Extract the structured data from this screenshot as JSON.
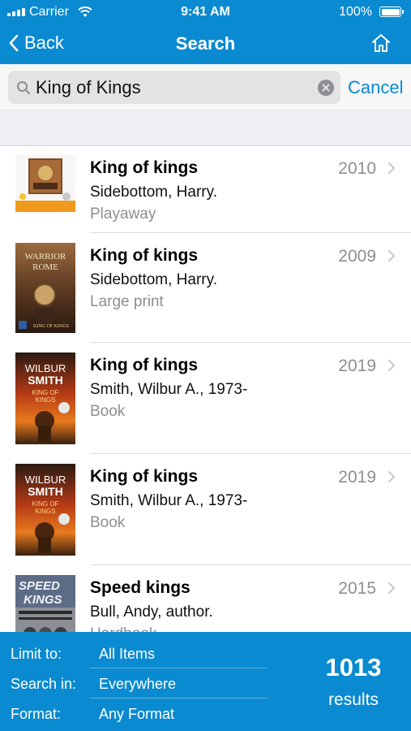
{
  "status_bar": {
    "carrier": "Carrier",
    "time": "9:41 AM",
    "battery": "100%"
  },
  "nav": {
    "back_label": "Back",
    "title": "Search",
    "home_icon": "home-icon"
  },
  "search": {
    "value": "King of Kings",
    "cancel_label": "Cancel"
  },
  "results": [
    {
      "title": "King of kings",
      "author": "Sidebottom, Harry.",
      "format": "Playaway",
      "year": "2010",
      "cover": "playaway"
    },
    {
      "title": "King of kings",
      "author": "Sidebottom, Harry.",
      "format": "Large print",
      "year": "2009",
      "cover": "warrior-of-rome",
      "cover_text": [
        "WARRIOR",
        "ROME",
        "KING OF KINGS"
      ]
    },
    {
      "title": "King of kings",
      "author": "Smith, Wilbur A., 1973-",
      "format": "Book",
      "year": "2019",
      "cover": "wilbur-smith",
      "cover_text": [
        "WILBUR",
        "SMITH",
        "KING OF",
        "KINGS"
      ]
    },
    {
      "title": "King of kings",
      "author": "Smith, Wilbur A., 1973-",
      "format": "Book",
      "year": "2019",
      "cover": "wilbur-smith",
      "cover_text": [
        "WILBUR",
        "SMITH",
        "KING OF",
        "KINGS"
      ]
    },
    {
      "title": "Speed kings",
      "author": "Bull, Andy, author.",
      "format": "Hardbook",
      "year": "2015",
      "cover": "speed-kings",
      "cover_text": [
        "SPEED",
        "KINGS"
      ]
    }
  ],
  "filters": [
    {
      "label": "Limit to:",
      "value": "All Items"
    },
    {
      "label": "Search in:",
      "value": "Everywhere"
    },
    {
      "label": "Format:",
      "value": "Any Format"
    }
  ],
  "summary": {
    "count": "1013",
    "count_label": "results"
  },
  "colors": {
    "accent": "#0a8ad0",
    "muted_text": "#8e8e93"
  }
}
